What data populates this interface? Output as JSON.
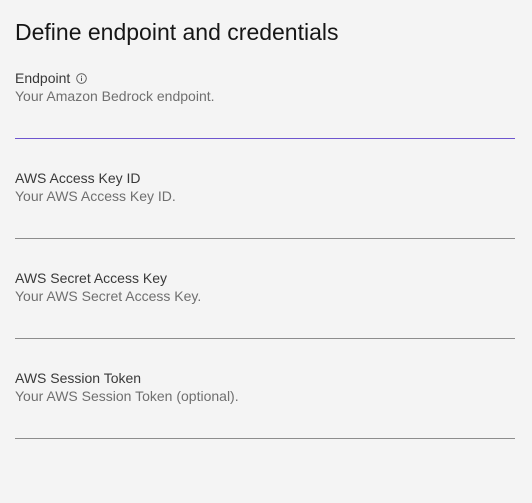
{
  "page": {
    "title": "Define endpoint and credentials"
  },
  "fields": [
    {
      "label": "Endpoint",
      "help": "Your Amazon Bedrock endpoint.",
      "value": "",
      "has_info_icon": true
    },
    {
      "label": "AWS Access Key ID",
      "help": "Your AWS Access Key ID.",
      "value": ""
    },
    {
      "label": "AWS Secret Access Key",
      "help": "Your AWS Secret Access Key.",
      "value": ""
    },
    {
      "label": "AWS Session Token",
      "help": "Your AWS Session Token (optional).",
      "value": ""
    }
  ],
  "colors": {
    "background": "#f4f4f4",
    "active_underline": "#6e56cf",
    "underline": "#8d8d8d"
  },
  "icons": {
    "endpoint_info": "info-circle-icon"
  }
}
